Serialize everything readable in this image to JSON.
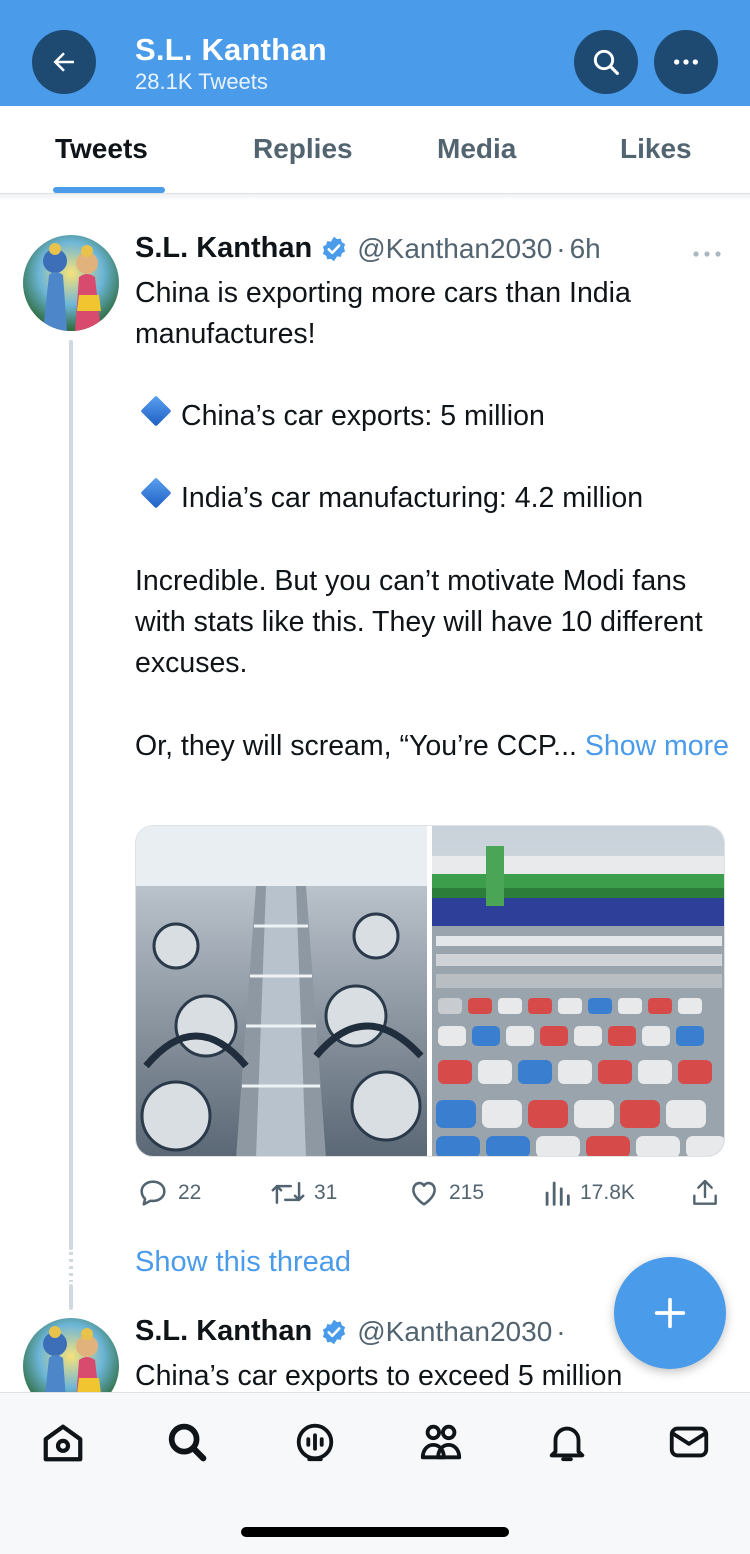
{
  "header": {
    "title": "S.L. Kanthan",
    "subtitle": "28.1K Tweets",
    "icons": [
      "arrow-left-icon",
      "search-icon",
      "more-horizontal-icon"
    ],
    "color": "#4a9bea"
  },
  "tabs": [
    {
      "label": "Tweets",
      "active": true
    },
    {
      "label": "Replies",
      "active": false
    },
    {
      "label": "Media",
      "active": false
    },
    {
      "label": "Likes",
      "active": false
    }
  ],
  "tweet1": {
    "name": "S.L. Kanthan",
    "handle": "@Kanthan2030",
    "separator": "·",
    "time": "6h",
    "text_intro": "China is exporting more cars than India manufactures!",
    "bullet1": "China’s car exports: 5 million",
    "bullet2": "India’s car manufacturing: 4.2 million",
    "paragraph": "Incredible. But you can’t motivate Modi fans with stats like this. They will have 10 different excuses.",
    "truncated": "Or, they will scream, “You’re CCP...",
    "show_more": "Show more",
    "media": [
      "car-factory-robots-image",
      "car-export-port-image"
    ],
    "actions": {
      "replies": "22",
      "retweets": "31",
      "likes": "215",
      "views": "17.8K"
    },
    "show_thread": "Show this thread"
  },
  "tweet2": {
    "name": "S.L. Kanthan",
    "handle": "@Kanthan2030",
    "separator": "·",
    "text": "China’s car exports to exceed 5 million"
  },
  "bottom_nav": [
    "home-icon",
    "search-icon",
    "spaces-icon",
    "communities-icon",
    "notifications-icon",
    "messages-icon"
  ]
}
